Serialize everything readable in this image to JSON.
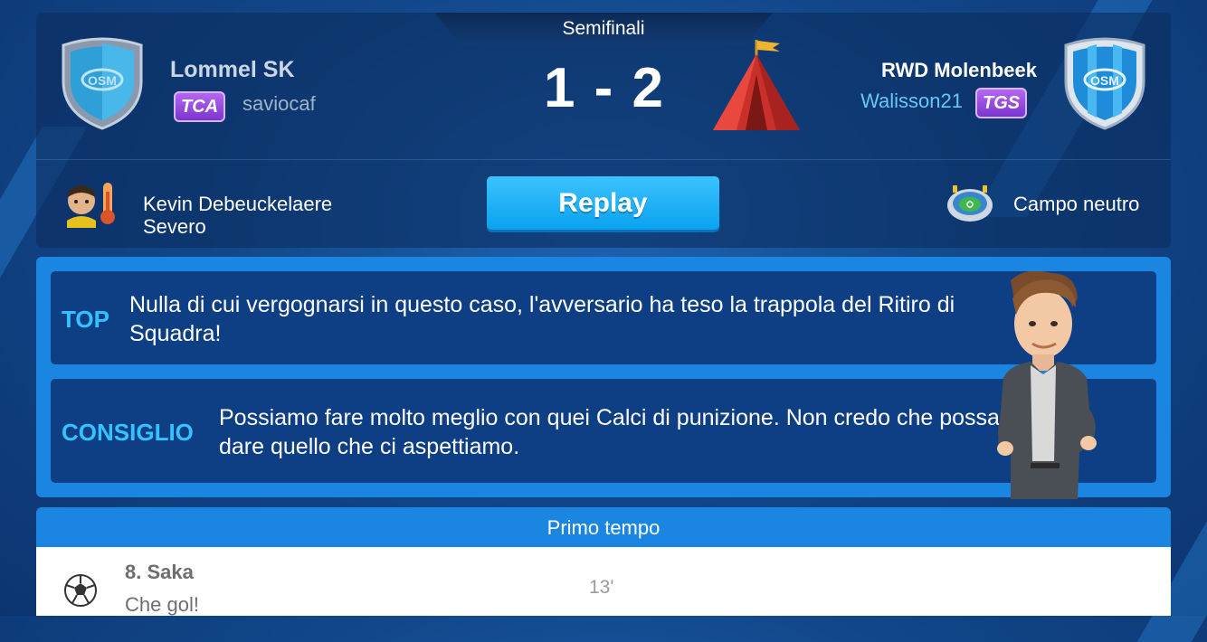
{
  "match": {
    "stage": "Semifinali",
    "score": "1 - 2",
    "home": {
      "name": "Lommel SK",
      "badge": "TCA",
      "manager": "saviocaf",
      "crest_text": "OSM"
    },
    "away": {
      "name": "RWD Molenbeek",
      "badge": "TGS",
      "manager": "Walisson21",
      "crest_text": "OSM"
    }
  },
  "info": {
    "coach_name": "Kevin Debeuckelaere",
    "coach_style": "Severo",
    "replay_label": "Replay",
    "venue": "Campo neutro"
  },
  "tips": [
    {
      "label": "TOP",
      "text": "Nulla di cui vergognarsi in questo caso, l'avversario ha teso la trappola del Ritiro di Squadra!"
    },
    {
      "label": "CONSIGLIO",
      "text": "Possiamo fare molto meglio con quei Calci di punizione. Non credo che possa dare quello che ci aspettiamo."
    }
  ],
  "events": {
    "section_title": "Primo tempo",
    "items": [
      {
        "player": "8. Saka",
        "comment": "Che gol!",
        "minute": "13'",
        "icon": "soccer-ball-icon"
      }
    ]
  },
  "colors": {
    "accent": "#34c3ff",
    "panel": "#1b86e2",
    "tip_bg": "#0e3f85",
    "badge": "#9b4fe0",
    "replay": "#17b0f7"
  }
}
